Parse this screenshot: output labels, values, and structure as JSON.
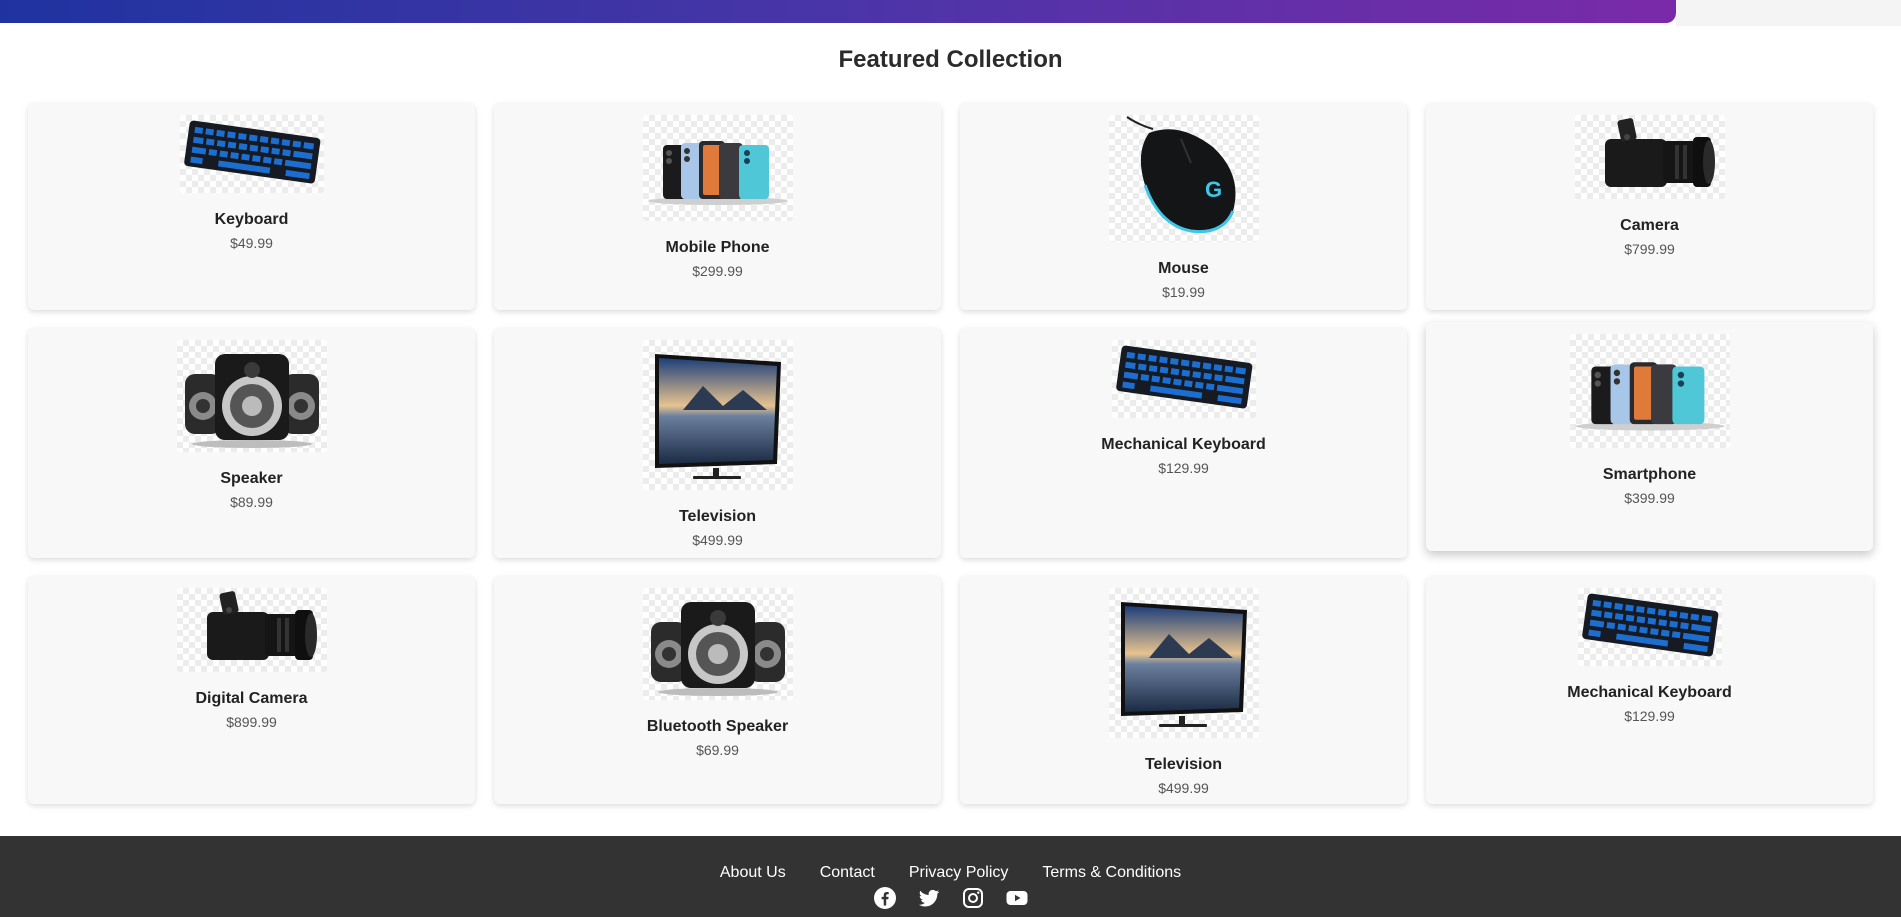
{
  "page": {
    "title": "Featured Collection"
  },
  "products": [
    [
      {
        "name": "Keyboard",
        "price": "$49.99",
        "image": "keyboard"
      },
      {
        "name": "Mobile Phone",
        "price": "$299.99",
        "image": "phones"
      },
      {
        "name": "Mouse",
        "price": "$19.99",
        "image": "mouse"
      },
      {
        "name": "Camera",
        "price": "$799.99",
        "image": "camera"
      }
    ],
    [
      {
        "name": "Speaker",
        "price": "$89.99",
        "image": "speaker"
      },
      {
        "name": "Television",
        "price": "$499.99",
        "image": "television"
      },
      {
        "name": "Mechanical Keyboard",
        "price": "$129.99",
        "image": "keyboard"
      },
      {
        "name": "Smartphone",
        "price": "$399.99",
        "image": "phones"
      }
    ],
    [
      {
        "name": "Digital Camera",
        "price": "$899.99",
        "image": "camera"
      },
      {
        "name": "Bluetooth Speaker",
        "price": "$69.99",
        "image": "speaker"
      },
      {
        "name": "Television",
        "price": "$499.99",
        "image": "television"
      },
      {
        "name": "Mechanical Keyboard",
        "price": "$129.99",
        "image": "keyboard"
      }
    ]
  ],
  "footer": {
    "links": [
      "About Us",
      "Contact",
      "Privacy Policy",
      "Terms & Conditions"
    ],
    "social": [
      "facebook-icon",
      "twitter-icon",
      "instagram-icon",
      "youtube-icon"
    ]
  },
  "colors": {
    "accent_start": "#1f33a0",
    "accent_end": "#7a2aa8",
    "footer_bg": "#333333"
  }
}
